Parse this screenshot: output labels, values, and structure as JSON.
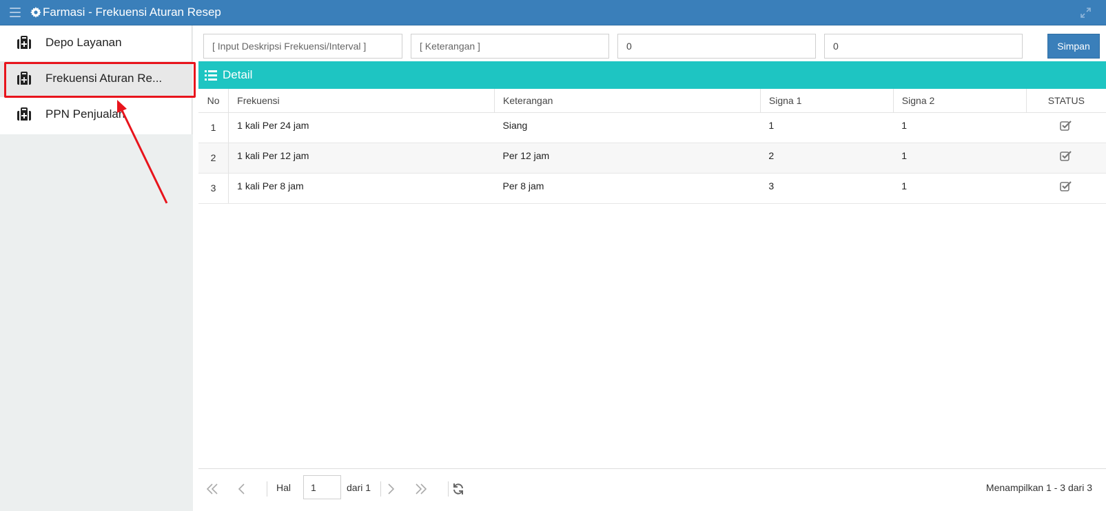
{
  "titlebar": {
    "title": "Farmasi - Frekuensi Aturan Resep",
    "menu_icon": "hamburger-icon",
    "title_icon": "gear-icon",
    "expand_icon": "expand-icon"
  },
  "sidebar": {
    "items": [
      {
        "label": "Depo Layanan",
        "icon": "medkit-icon"
      },
      {
        "label": "Frekuensi Aturan Re...",
        "icon": "medkit-icon",
        "active": true
      },
      {
        "label": "PPN Penjualan",
        "icon": "medkit-icon"
      }
    ]
  },
  "form": {
    "deskripsi_placeholder": "[ Input Deskripsi Frekuensi/Interval ]",
    "keterangan_placeholder": "[ Keterangan ]",
    "signa1_value": "0",
    "signa2_value": "0",
    "save_label": "Simpan"
  },
  "detail": {
    "label": "Detail",
    "columns": [
      "No",
      "Frekuensi",
      "Keterangan",
      "Signa 1",
      "Signa 2",
      "STATUS"
    ],
    "rows": [
      {
        "no": "1",
        "frekuensi": "1 kali Per 24 jam",
        "keterangan": "Siang",
        "signa1": "1",
        "signa2": "1",
        "status": true
      },
      {
        "no": "2",
        "frekuensi": "1 kali Per 12 jam",
        "keterangan": "Per 12 jam",
        "signa1": "2",
        "signa2": "1",
        "status": true
      },
      {
        "no": "3",
        "frekuensi": "1 kali Per 8 jam",
        "keterangan": "Per 8 jam",
        "signa1": "3",
        "signa2": "1",
        "status": true
      }
    ]
  },
  "pager": {
    "hal_label": "Hal",
    "page_value": "1",
    "of_label": "dari 1",
    "summary": "Menampilkan 1 - 3 dari 3"
  },
  "colors": {
    "titlebar": "#3a7fba",
    "detail_bar": "#1ec5c2",
    "highlight": "#e8141c"
  }
}
